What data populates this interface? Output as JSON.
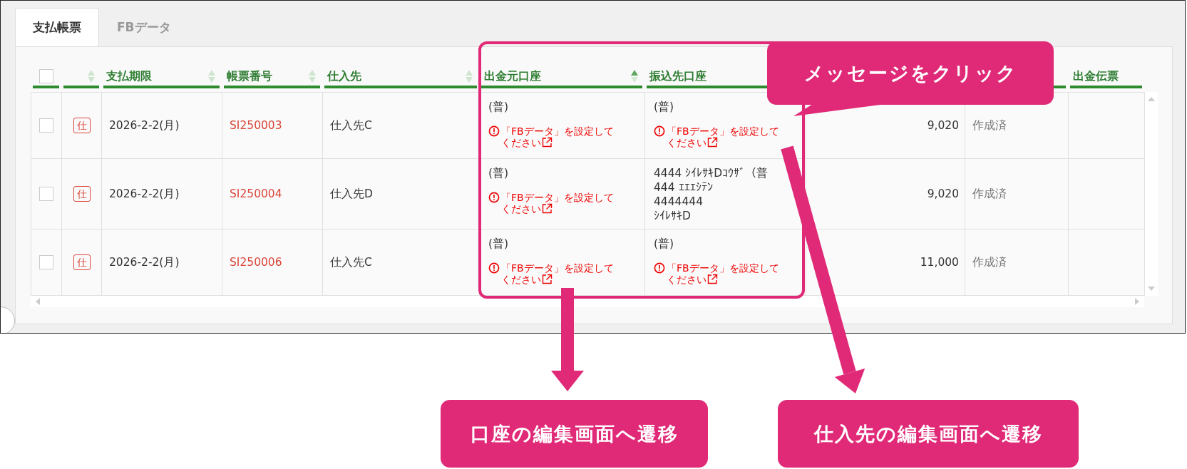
{
  "tabs": [
    {
      "label": "支払帳票",
      "selected": true
    },
    {
      "label": "FBデータ",
      "selected": false
    }
  ],
  "table": {
    "columns": [
      {
        "kind": "checkbox",
        "checked": false
      },
      {
        "kind": "sort",
        "sorted": false
      },
      {
        "kind": "text",
        "label": "支払期限",
        "sorted": false
      },
      {
        "kind": "text",
        "label": "帳票番号",
        "sorted": false
      },
      {
        "kind": "text",
        "label": "仕入先",
        "sorted": false
      },
      {
        "kind": "text",
        "label": "出金元口座",
        "sorted": true
      },
      {
        "kind": "text",
        "label": "振込先口座"
      },
      {
        "kind": "text",
        "label": "出金伝票"
      }
    ],
    "rows": [
      {
        "checked": false,
        "badge": "仕",
        "due": "2026-2-2(月)",
        "number": "SI250003",
        "supplier": "仕入先C",
        "source_account": {
          "kind": "warning",
          "label": "(普)",
          "warning": "「FBデータ」を設定してください"
        },
        "dest_account": {
          "kind": "warning",
          "label": "(普)",
          "warning": "「FBデータ」を設定してください"
        },
        "amount": "9,020",
        "status": "作成済"
      },
      {
        "checked": false,
        "badge": "仕",
        "due": "2026-2-2(月)",
        "number": "SI250004",
        "supplier": "仕入先D",
        "source_account": {
          "kind": "warning",
          "label": "(普)",
          "warning": "「FBデータ」を設定してください"
        },
        "dest_account": {
          "kind": "lines",
          "lines": [
            "4444 ｼｲﾚｻｷDｺｳｻﾞ（普",
            "444 ｴｴｴｼﾃﾝ",
            "4444444",
            "ｼｲﾚｻｷD"
          ]
        },
        "amount": "9,020",
        "status": "作成済"
      },
      {
        "checked": false,
        "badge": "仕",
        "due": "2026-2-2(月)",
        "number": "SI250006",
        "supplier": "仕入先C",
        "source_account": {
          "kind": "warning",
          "label": "(普)",
          "warning": "「FBデータ」を設定してください"
        },
        "dest_account": {
          "kind": "warning",
          "label": "(普)",
          "warning": "「FBデータ」を設定してください"
        },
        "amount": "11,000",
        "status": "作成済"
      }
    ]
  },
  "annotations": {
    "callout": "メッセージをクリック",
    "notes": [
      "口座の編集画面へ遷移",
      "仕入先の編集画面へ遷移"
    ]
  }
}
